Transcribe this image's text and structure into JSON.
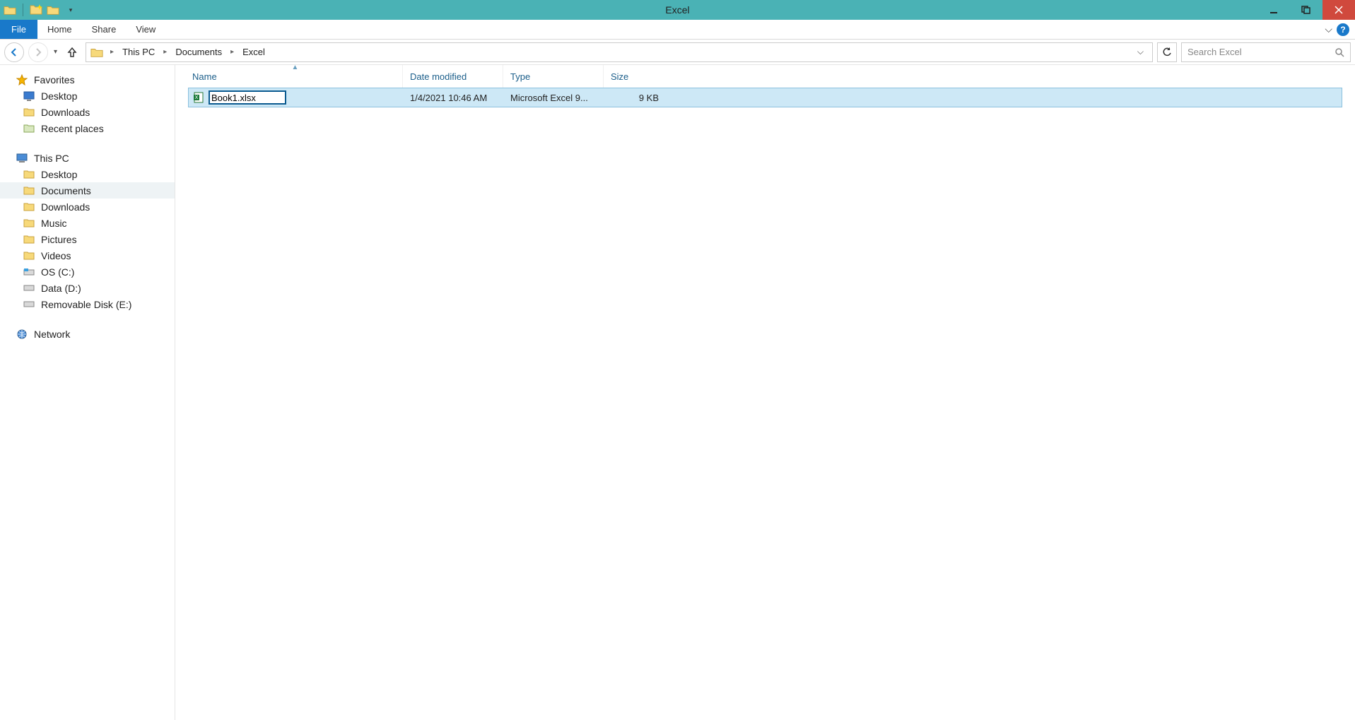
{
  "window": {
    "title": "Excel"
  },
  "ribbon": {
    "file": "File",
    "tabs": [
      "Home",
      "Share",
      "View"
    ]
  },
  "breadcrumb": {
    "items": [
      "This PC",
      "Documents",
      "Excel"
    ]
  },
  "search": {
    "placeholder": "Search Excel"
  },
  "sidebar": {
    "favorites": {
      "label": "Favorites",
      "items": [
        "Desktop",
        "Downloads",
        "Recent places"
      ]
    },
    "thispc": {
      "label": "This PC",
      "items": [
        "Desktop",
        "Documents",
        "Downloads",
        "Music",
        "Pictures",
        "Videos",
        "OS (C:)",
        "Data (D:)",
        "Removable Disk (E:)"
      ],
      "selected_index": 1
    },
    "network": {
      "label": "Network"
    }
  },
  "columns": {
    "name": "Name",
    "date": "Date modified",
    "type": "Type",
    "size": "Size"
  },
  "files": [
    {
      "name": "Book1.xlsx",
      "date": "1/4/2021 10:46 AM",
      "type": "Microsoft Excel 9...",
      "size": "9 KB",
      "renaming": true,
      "selected": true
    }
  ]
}
